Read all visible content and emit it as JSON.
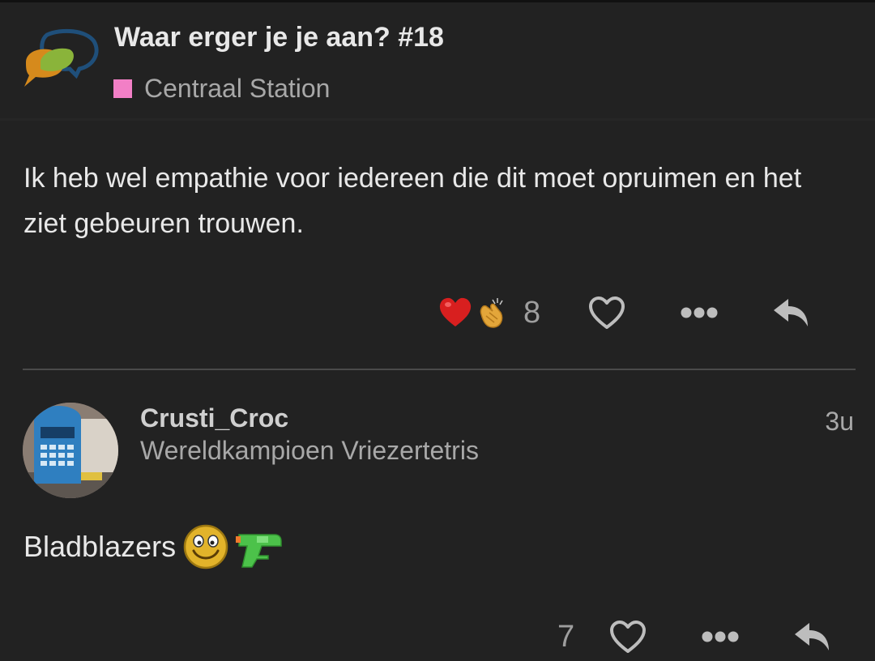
{
  "topic": {
    "title": "Waar erger je je aan? #18",
    "category": "Centraal Station",
    "category_color": "#f27fc6"
  },
  "post1": {
    "text": "Ik heb wel empathie voor iedereen die dit moet opruimen en het ziet gebeuren trouwen.",
    "reactions": [
      "heart-emoji",
      "clapping-hands-emoji"
    ],
    "reaction_count": "8"
  },
  "post2": {
    "username": "Crusti_Croc",
    "user_title": "Wereldkampioen Vriezertetris",
    "time": "3u",
    "text": "Bladblazers",
    "inline_emojis": [
      "smiley-emoji",
      "water-pistol-emoji"
    ],
    "reaction_count": "7"
  },
  "icons": {
    "like": "heart-outline-icon",
    "more": "ellipsis-icon",
    "reply": "reply-arrow-icon"
  }
}
